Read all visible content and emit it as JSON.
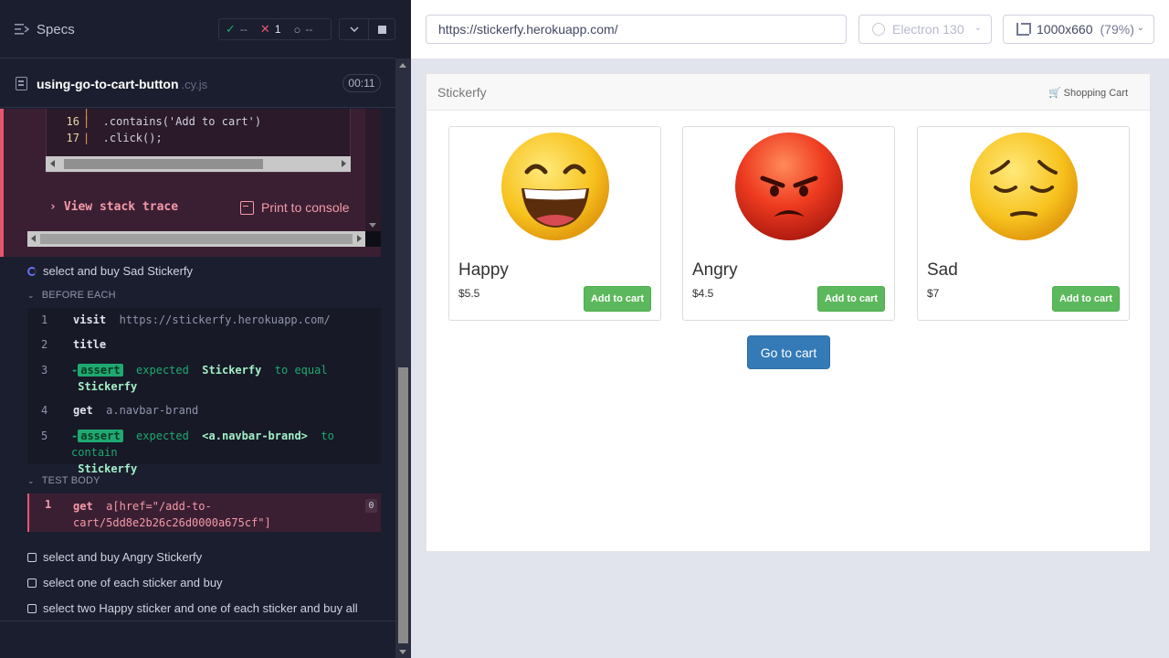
{
  "reporter": {
    "title": "Specs",
    "stats": {
      "passed": "--",
      "failed": "1",
      "pending": "--"
    },
    "spec": {
      "name": "using-go-to-cart-button",
      "ext": ".cy.js",
      "duration": "00:11"
    },
    "error": {
      "code_lines": [
        {
          "num": "16",
          "text": "  .contains('Add to cart')"
        },
        {
          "num": "17",
          "text": "  .click();"
        }
      ],
      "view_stack_trace": "View stack trace",
      "print_to_console": "Print to console"
    },
    "current_test": "select and buy Sad Stickerfy",
    "before_each": {
      "label": "BEFORE EACH",
      "commands": [
        {
          "num": "1",
          "name": "visit",
          "message": "https://stickerfy.herokuapp.com/"
        },
        {
          "num": "2",
          "name": "title",
          "message": ""
        },
        {
          "num": "3",
          "badge": "assert",
          "pre": "expected",
          "subject": "Stickerfy",
          "mid": "to equal",
          "value": "Stickerfy"
        },
        {
          "num": "4",
          "name": "get",
          "message": "a.navbar-brand"
        },
        {
          "num": "5",
          "badge": "assert",
          "pre": "expected",
          "subject": "<a.navbar-brand>",
          "mid": "to contain",
          "value": "Stickerfy"
        }
      ]
    },
    "test_body": {
      "label": "TEST BODY",
      "command": {
        "num": "1",
        "name": "get",
        "message": "a[href=\"/add-to-cart/5dd8e2b26c26d0000a675cf\"]",
        "message_line1": "a[href=\"/add-to-",
        "message_line2": "cart/5dd8e2b26c26d0000a675cf\"]",
        "count": "0"
      }
    },
    "other_tests": [
      "select and buy Angry Stickerfy",
      "select one of each sticker and buy",
      "select two Happy sticker and one of each sticker and buy all"
    ]
  },
  "aut": {
    "url": "https://stickerfy.herokuapp.com/",
    "browser": "Electron 130",
    "viewport": "1000x660",
    "scale": "(79%)",
    "app": {
      "brand": "Stickerfy",
      "cart_link": "Shopping Cart",
      "products": [
        {
          "name": "Happy",
          "price": "$5.5",
          "button": "Add to cart",
          "emoji": "happy-face"
        },
        {
          "name": "Angry",
          "price": "$4.5",
          "button": "Add to cart",
          "emoji": "angry-face"
        },
        {
          "name": "Sad",
          "price": "$7",
          "button": "Add to cart",
          "emoji": "sad-face"
        }
      ],
      "go_to_cart": "Go to cart"
    }
  },
  "colors": {
    "passed": "#1fa971",
    "failed": "#e45770",
    "add_button": "#5cb85c",
    "primary_button": "#337ab7"
  }
}
